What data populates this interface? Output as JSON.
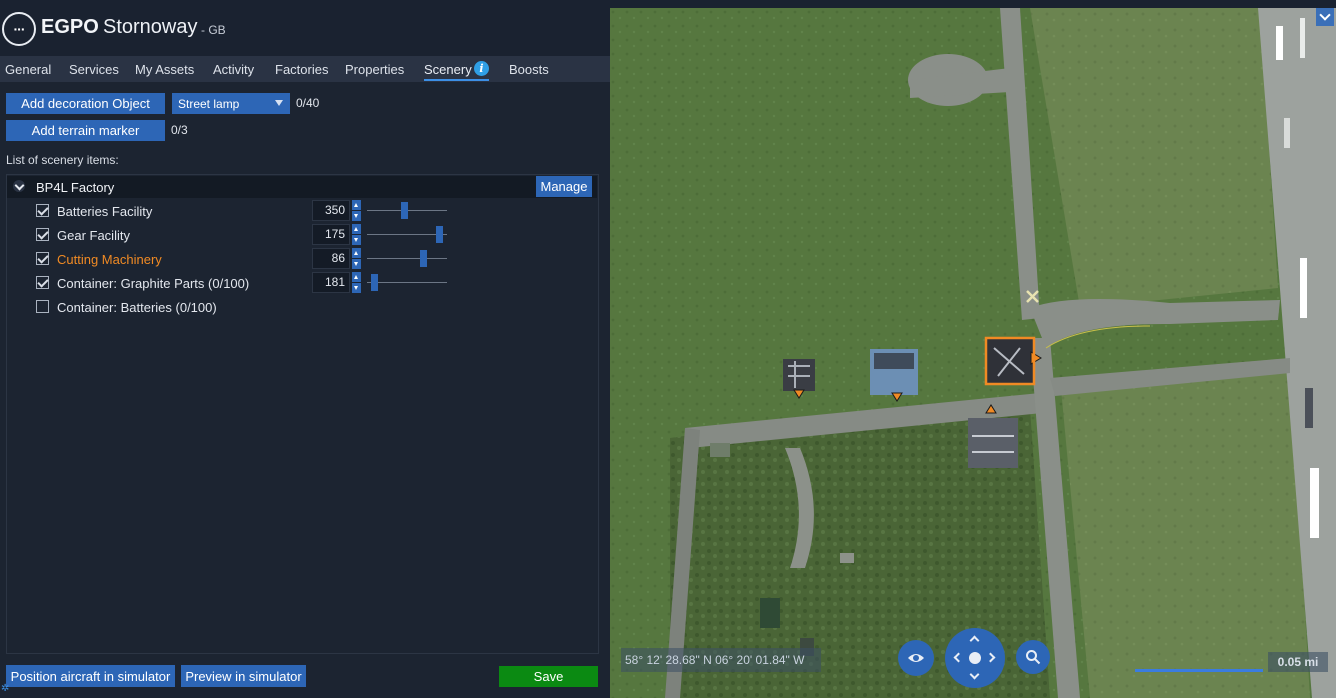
{
  "header": {
    "menu_glyph": "···",
    "icao": "EGPO",
    "city": "Stornoway",
    "country": "- GB"
  },
  "tabs": [
    {
      "label": "General"
    },
    {
      "label": "Services"
    },
    {
      "label": "My Assets"
    },
    {
      "label": "Activity"
    },
    {
      "label": "Factories"
    },
    {
      "label": "Properties"
    },
    {
      "label": "Scenery",
      "active": true
    },
    {
      "label": "Boosts"
    }
  ],
  "scenery": {
    "add_decoration_label": "Add decoration Object",
    "decoration_select_value": "Street lamp",
    "decoration_count": "0/40",
    "add_terrain_label": "Add terrain marker",
    "terrain_count": "0/3",
    "list_label": "List of scenery items:",
    "group": {
      "title": "BP4L Factory",
      "manage_label": "Manage",
      "items": [
        {
          "label": "Batteries Facility",
          "checked": true,
          "value": "350",
          "slider_fraction": 0.47,
          "highlight": false
        },
        {
          "label": "Gear Facility",
          "checked": true,
          "value": "175",
          "slider_fraction": 0.95,
          "highlight": false
        },
        {
          "label": "Cutting Machinery",
          "checked": true,
          "value": "86",
          "slider_fraction": 0.72,
          "highlight": true
        },
        {
          "label": "Container: Graphite Parts (0/100)",
          "checked": true,
          "value": "181",
          "slider_fraction": 0.05,
          "highlight": false
        },
        {
          "label": "Container: Batteries (0/100)",
          "checked": false,
          "value": null,
          "slider_fraction": null,
          "highlight": false
        }
      ]
    }
  },
  "footer": {
    "position_label": "Position aircraft in simulator",
    "preview_label": "Preview in simulator",
    "save_label": "Save"
  },
  "map": {
    "coordinates": "58° 12' 28.68\" N 06° 20' 01.84\" W",
    "scale_label": "0.05 mi",
    "icons": [
      "eye-icon",
      "navigation-pad",
      "magnifier-icon",
      "collapse-chevron-icon"
    ]
  },
  "colors": {
    "accent_blue": "#2d66b6",
    "save_green": "#0b8a12",
    "highlight_orange": "#f08a24",
    "panel_bg": "#1c2431"
  }
}
